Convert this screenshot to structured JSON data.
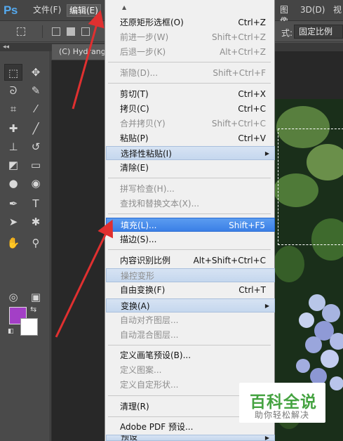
{
  "app": {
    "logo": "Ps"
  },
  "menubar": {
    "items": [
      "文件(F)",
      "编辑(E)",
      "图像(I)",
      "3D(D)",
      "视"
    ]
  },
  "options_bar": {
    "style_label": "式:",
    "style_value": "固定比例"
  },
  "document": {
    "tab_title": "(C) Hydrangea"
  },
  "edit_menu": {
    "items": [
      {
        "label": "还原矩形选框(O)",
        "shortcut": "Ctrl+Z",
        "state": "normal"
      },
      {
        "label": "前进一步(W)",
        "shortcut": "Shift+Ctrl+Z",
        "state": "disabled"
      },
      {
        "label": "后退一步(K)",
        "shortcut": "Alt+Ctrl+Z",
        "state": "disabled"
      },
      {
        "label": "渐隐(D)...",
        "shortcut": "Shift+Ctrl+F",
        "state": "disabled"
      },
      {
        "label": "剪切(T)",
        "shortcut": "Ctrl+X",
        "state": "normal"
      },
      {
        "label": "拷贝(C)",
        "shortcut": "Ctrl+C",
        "state": "normal"
      },
      {
        "label": "合并拷贝(Y)",
        "shortcut": "Shift+Ctrl+C",
        "state": "disabled"
      },
      {
        "label": "粘贴(P)",
        "shortcut": "Ctrl+V",
        "state": "normal"
      },
      {
        "label": "选择性粘贴(I)",
        "shortcut": "",
        "state": "submenu"
      },
      {
        "label": "清除(E)",
        "shortcut": "",
        "state": "normal"
      },
      {
        "label": "拼写检查(H)...",
        "shortcut": "",
        "state": "disabled"
      },
      {
        "label": "查找和替换文本(X)...",
        "shortcut": "",
        "state": "disabled"
      },
      {
        "label": "填充(L)...",
        "shortcut": "Shift+F5",
        "state": "highlighted"
      },
      {
        "label": "描边(S)...",
        "shortcut": "",
        "state": "normal"
      },
      {
        "label": "内容识别比例",
        "shortcut": "Alt+Shift+Ctrl+C",
        "state": "normal"
      },
      {
        "label": "操控变形",
        "shortcut": "",
        "state": "disabled"
      },
      {
        "label": "自由变换(F)",
        "shortcut": "Ctrl+T",
        "state": "normal"
      },
      {
        "label": "变换(A)",
        "shortcut": "",
        "state": "submenu"
      },
      {
        "label": "自动对齐图层...",
        "shortcut": "",
        "state": "disabled"
      },
      {
        "label": "自动混合图层...",
        "shortcut": "",
        "state": "disabled"
      },
      {
        "label": "定义画笔预设(B)...",
        "shortcut": "",
        "state": "normal"
      },
      {
        "label": "定义图案...",
        "shortcut": "",
        "state": "disabled"
      },
      {
        "label": "定义自定形状...",
        "shortcut": "",
        "state": "disabled"
      },
      {
        "label": "清理(R)",
        "shortcut": "",
        "state": "normal"
      },
      {
        "label": "Adobe PDF 预设...",
        "shortcut": "",
        "state": "normal"
      },
      {
        "label": "预设",
        "shortcut": "",
        "state": "submenu"
      }
    ]
  },
  "toolbar": {
    "foreground_color": "#a33fc6",
    "background_color": "#ffffff",
    "tools": [
      "rect-marquee-icon",
      "move-icon",
      "lasso-icon",
      "quick-select-icon",
      "crop-icon",
      "eyedropper-icon",
      "healing-brush-icon",
      "brush-icon",
      "clone-stamp-icon",
      "history-brush-icon",
      "eraser-icon",
      "gradient-icon",
      "blur-icon",
      "dodge-icon",
      "pen-icon",
      "type-icon",
      "path-select-icon",
      "custom-shape-icon",
      "hand-icon",
      "zoom-icon"
    ]
  },
  "watermark": {
    "title": "百科全说",
    "subtitle": "助你轻松解决"
  },
  "colors": {
    "highlight": "#3b80e6",
    "arrow": "#e03030",
    "watermark_green": "#45a341"
  }
}
